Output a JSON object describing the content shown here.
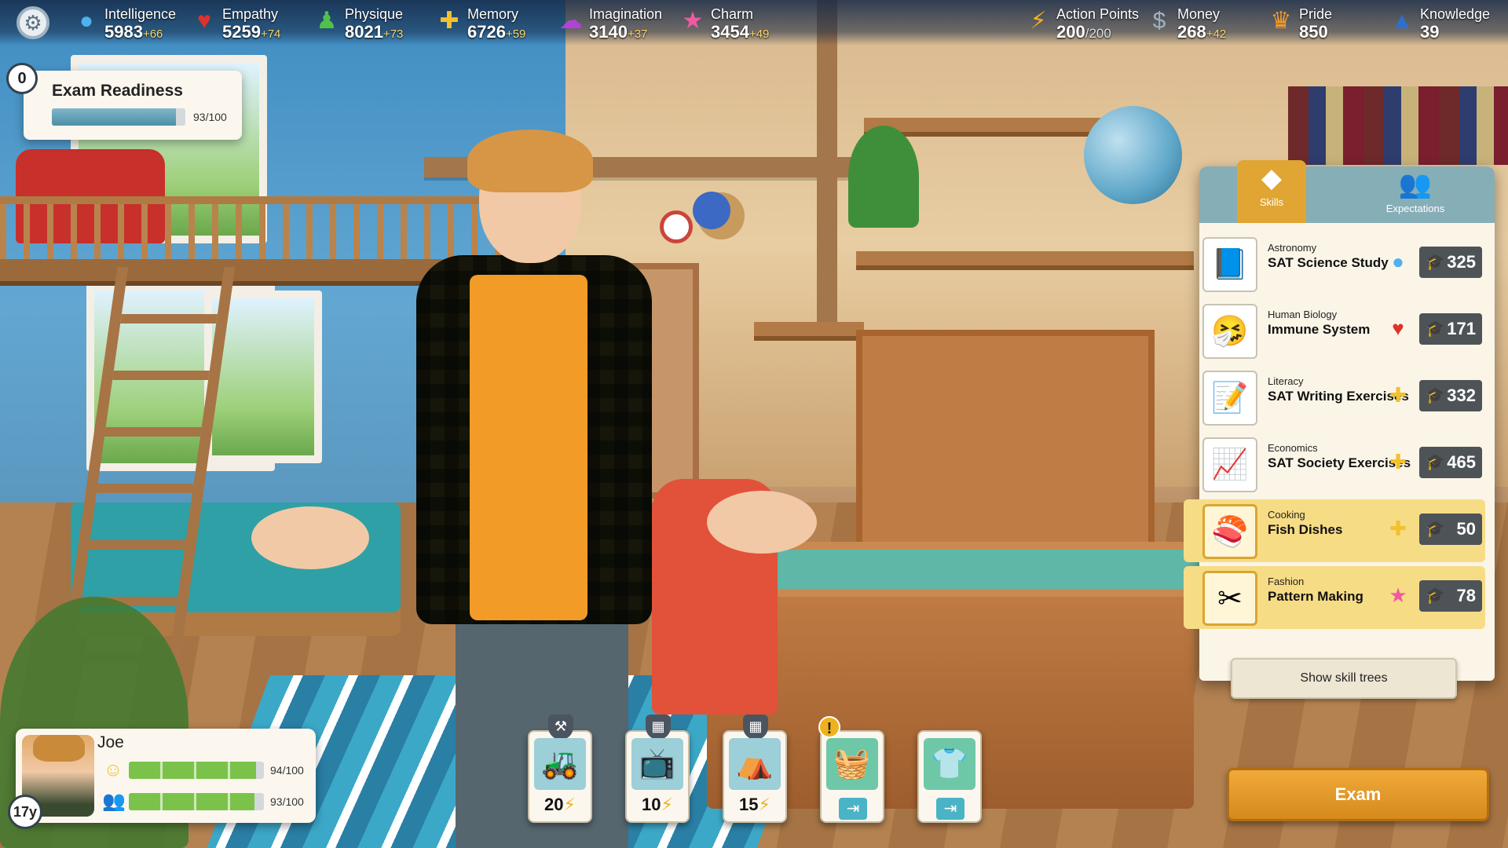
{
  "topbar": {
    "stats": [
      {
        "label": "Intelligence",
        "value": "5983",
        "inc": "+66",
        "icon": "lightbulb-icon"
      },
      {
        "label": "Empathy",
        "value": "5259",
        "inc": "+74",
        "icon": "heart-icon"
      },
      {
        "label": "Physique",
        "value": "8021",
        "inc": "+73",
        "icon": "person-icon"
      },
      {
        "label": "Memory",
        "value": "6726",
        "inc": "+59",
        "icon": "puzzle-icon"
      },
      {
        "label": "Imagination",
        "value": "3140",
        "inc": "+37",
        "icon": "cloud-icon"
      },
      {
        "label": "Charm",
        "value": "3454",
        "inc": "+49",
        "icon": "star-icon"
      }
    ],
    "resources": [
      {
        "label": "Action Points",
        "value": "200",
        "max": "/200",
        "icon": "lightning-icon"
      },
      {
        "label": "Money",
        "value": "268",
        "inc": "+42",
        "icon": "coin-icon"
      },
      {
        "label": "Pride",
        "value": "850",
        "icon": "crown-icon"
      },
      {
        "label": "Knowledge",
        "value": "39",
        "icon": "graduation-cap-icon"
      }
    ]
  },
  "exam_readiness": {
    "badge": "0",
    "title": "Exam Readiness",
    "value": 93,
    "max": 100,
    "text": "93/100"
  },
  "skills_panel": {
    "tabs": [
      {
        "label": "Skills",
        "active": true
      },
      {
        "label": "Expectations",
        "active": false
      }
    ],
    "rows": [
      {
        "category": "Astronomy",
        "name": "SAT Science Study",
        "stat_icon": "lightbulb-icon",
        "xp": "325",
        "highlight": false
      },
      {
        "category": "Human Biology",
        "name": "Immune System",
        "stat_icon": "heart-icon",
        "xp": "171",
        "highlight": false
      },
      {
        "category": "Literacy",
        "name": "SAT Writing Exercises",
        "stat_icon": "puzzle-icon",
        "xp": "332",
        "highlight": false
      },
      {
        "category": "Economics",
        "name": "SAT Society Exercises",
        "stat_icon": "puzzle-icon",
        "xp": "465",
        "highlight": false
      },
      {
        "category": "Cooking",
        "name": "Fish Dishes",
        "stat_icon": "puzzle-icon",
        "xp": "50",
        "highlight": true
      },
      {
        "category": "Fashion",
        "name": "Pattern Making",
        "stat_icon": "star-icon",
        "xp": "78",
        "highlight": true
      }
    ],
    "show_trees_label": "Show skill trees"
  },
  "exam_button": {
    "label": "Exam"
  },
  "character": {
    "name": "Joe",
    "age": "17y",
    "happiness": {
      "value": 94,
      "max": 100,
      "text": "94/100",
      "icon": "smiley-icon"
    },
    "social": {
      "value": 93,
      "max": 100,
      "text": "93/100",
      "icon": "people-icon"
    }
  },
  "actions": [
    {
      "name": "lawn-mowing",
      "icon": "lawnmower-icon",
      "tag": "hammer-icon",
      "cost": "20"
    },
    {
      "name": "watch-tv",
      "icon": "tv-icon",
      "tag": "calendar-icon",
      "cost": "10"
    },
    {
      "name": "camping",
      "icon": "tent-icon",
      "tag": "calendar-icon",
      "cost": "15"
    },
    {
      "name": "shop",
      "icon": "basket-icon",
      "alert": "!",
      "go": "enter-icon"
    },
    {
      "name": "wardrobe",
      "icon": "shirt-icon",
      "go": "enter-icon"
    }
  ],
  "colors": {
    "accent": "#e0a532",
    "panel_bg": "#fbf5e7",
    "tab_bar": "#86aeb7",
    "bar_fill": "#7bc24a",
    "readiness_fill": "#4e8ea6"
  }
}
